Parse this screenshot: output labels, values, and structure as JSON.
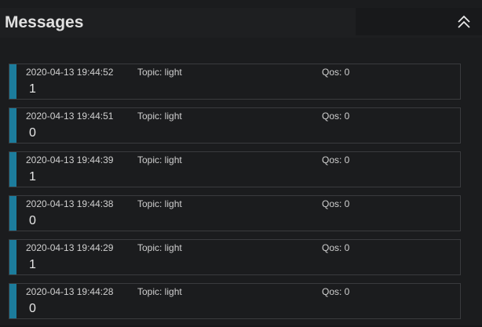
{
  "panel": {
    "title": "Messages"
  },
  "messages": [
    {
      "timestamp": "2020-04-13 19:44:52",
      "topic": "Topic: light",
      "qos": "Qos: 0",
      "payload": "1"
    },
    {
      "timestamp": "2020-04-13 19:44:51",
      "topic": "Topic: light",
      "qos": "Qos: 0",
      "payload": "0"
    },
    {
      "timestamp": "2020-04-13 19:44:39",
      "topic": "Topic: light",
      "qos": "Qos: 0",
      "payload": "1"
    },
    {
      "timestamp": "2020-04-13 19:44:38",
      "topic": "Topic: light",
      "qos": "Qos: 0",
      "payload": "0"
    },
    {
      "timestamp": "2020-04-13 19:44:29",
      "topic": "Topic: light",
      "qos": "Qos: 0",
      "payload": "1"
    },
    {
      "timestamp": "2020-04-13 19:44:28",
      "topic": "Topic: light",
      "qos": "Qos: 0",
      "payload": "0"
    }
  ],
  "colors": {
    "accent_bar": "#1c7c9c",
    "background": "#1b1c1e"
  },
  "icons": {
    "collapse": "double-chevron-up-icon"
  }
}
